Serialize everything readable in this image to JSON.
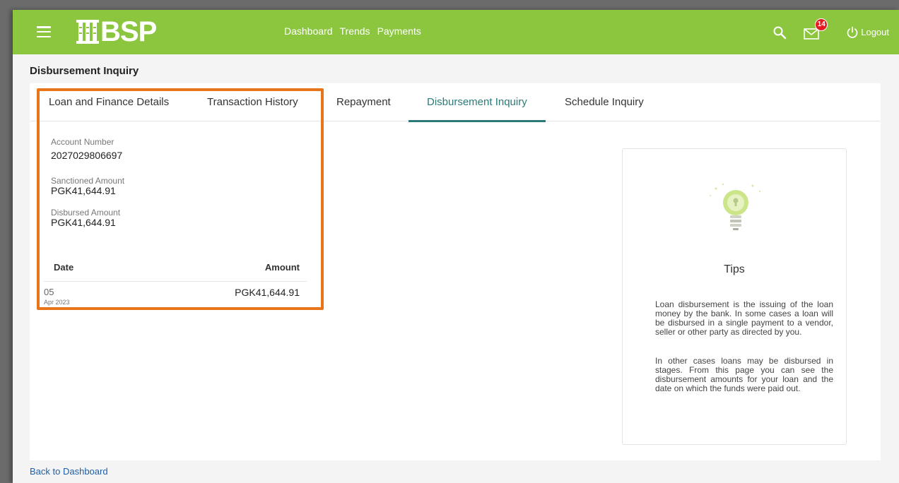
{
  "app": {
    "brand_text": "BSP",
    "accent": "#8cc63f",
    "tab_accent": "#2b7a78",
    "highlight_color": "#e8751a"
  },
  "header": {
    "nav": [
      "Dashboard",
      "Trends",
      "Payments"
    ],
    "notification_count": "14",
    "logout_label": "Logout",
    "icons": [
      "hamburger-menu-icon",
      "search-icon",
      "mail-icon",
      "power-icon"
    ]
  },
  "page": {
    "title": "Disbursement Inquiry"
  },
  "tabs": [
    {
      "label": "Loan and Finance Details"
    },
    {
      "label": "Transaction History"
    },
    {
      "label": "Repayment"
    },
    {
      "label": "Disbursement Inquiry",
      "active": true
    },
    {
      "label": "Schedule Inquiry"
    }
  ],
  "details": {
    "account_number_label": "Account Number",
    "account_number": "2027029806697",
    "sanctioned_label": "Sanctioned Amount",
    "sanctioned_amount": "PGK41,644.91",
    "disbursed_label": "Disbursed Amount",
    "disbursed_amount": "PGK41,644.91"
  },
  "table": {
    "columns": [
      "Date",
      "Amount"
    ],
    "rows": [
      {
        "day": "05",
        "month_year": "Apr  2023",
        "amount": "PGK41,644.91"
      }
    ]
  },
  "tips": {
    "title": "Tips",
    "paragraph1": "Loan disbursement is the issuing of the loan money by the bank. In some cases a loan will be disbursed in a single payment to a vendor, seller or other party as directed by you.",
    "paragraph2": "In other cases loans may be disbursed in stages. From this page you can see the disbursement amounts for your loan and the date on which the funds were paid out."
  },
  "footer": {
    "back_link": "Back to Dashboard"
  }
}
